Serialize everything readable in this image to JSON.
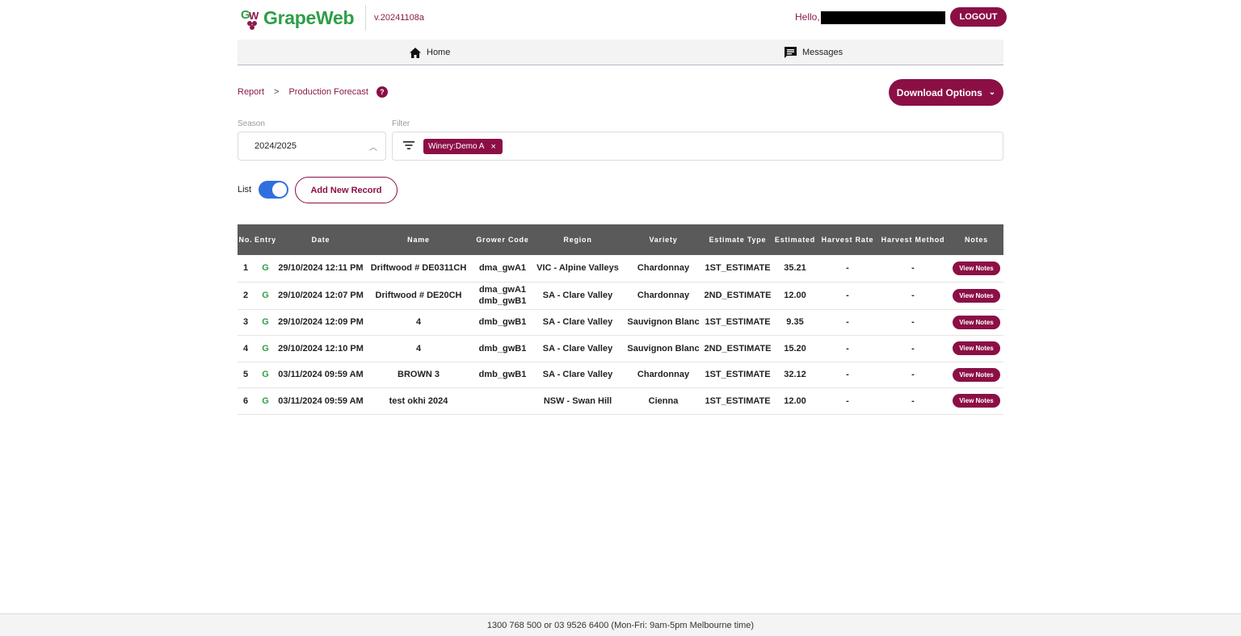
{
  "app": {
    "name": "GrapeWeb",
    "version": "v.20241108a"
  },
  "header": {
    "greeting": "Hello,",
    "logout_label": "LOGOUT"
  },
  "nav": {
    "items": [
      {
        "label": "Home",
        "icon": "home-icon"
      },
      {
        "label": "Messages",
        "icon": "message-icon"
      }
    ]
  },
  "breadcrumb": {
    "items": [
      "Report",
      "Production Forecast"
    ],
    "separator": ">",
    "help": "?"
  },
  "download": {
    "label": "Download Options",
    "chevron": "⌄"
  },
  "season": {
    "label": "Season",
    "value": "2024/2025"
  },
  "filter": {
    "label": "Filter",
    "chips": [
      {
        "label": "Winery:Demo A",
        "remove": "×"
      }
    ]
  },
  "view_toggle": {
    "label": "List",
    "on": true
  },
  "add_button": {
    "label": "Add New Record"
  },
  "table": {
    "headers": [
      "No.",
      "Entry",
      "Date",
      "Name",
      "Grower Code",
      "Region",
      "Variety",
      "Estimate Type",
      "Estimated",
      "Harvest Rate",
      "Harvest Method",
      "Notes"
    ],
    "rows": [
      {
        "no": "1",
        "entry": "G",
        "date": "29/10/2024 12:11 PM",
        "name": "Driftwood # DE0311CH",
        "grower_code": [
          "dma_gwA1"
        ],
        "region": "VIC - Alpine Valleys",
        "variety": "Chardonnay",
        "estimate_type": "1ST_ESTIMATE",
        "estimated": "35.21",
        "harvest_rate": "-",
        "harvest_method": "-",
        "notes": "View Notes"
      },
      {
        "no": "2",
        "entry": "G",
        "date": "29/10/2024 12:07 PM",
        "name": "Driftwood # DE20CH",
        "grower_code": [
          "dma_gwA1",
          "dmb_gwB1"
        ],
        "region": "SA - Clare Valley",
        "variety": "Chardonnay",
        "estimate_type": "2ND_ESTIMATE",
        "estimated": "12.00",
        "harvest_rate": "-",
        "harvest_method": "-",
        "notes": "View Notes"
      },
      {
        "no": "3",
        "entry": "G",
        "date": "29/10/2024 12:09 PM",
        "name": "4",
        "grower_code": [
          "dmb_gwB1"
        ],
        "region": "SA - Clare Valley",
        "variety": "Sauvignon Blanc",
        "estimate_type": "1ST_ESTIMATE",
        "estimated": "9.35",
        "harvest_rate": "-",
        "harvest_method": "-",
        "notes": "View Notes"
      },
      {
        "no": "4",
        "entry": "G",
        "date": "29/10/2024 12:10 PM",
        "name": "4",
        "grower_code": [
          "dmb_gwB1"
        ],
        "region": "SA - Clare Valley",
        "variety": "Sauvignon Blanc",
        "estimate_type": "2ND_ESTIMATE",
        "estimated": "15.20",
        "harvest_rate": "-",
        "harvest_method": "-",
        "notes": "View Notes"
      },
      {
        "no": "5",
        "entry": "G",
        "date": "03/11/2024 09:59 AM",
        "name": "BROWN 3",
        "grower_code": [
          "dmb_gwB1"
        ],
        "region": "SA - Clare Valley",
        "variety": "Chardonnay",
        "estimate_type": "1ST_ESTIMATE",
        "estimated": "32.12",
        "harvest_rate": "-",
        "harvest_method": "-",
        "notes": "View Notes"
      },
      {
        "no": "6",
        "entry": "G",
        "date": "03/11/2024 09:59 AM",
        "name": "test okhi 2024",
        "grower_code": [],
        "region": "NSW - Swan Hill",
        "variety": "Cienna",
        "estimate_type": "1ST_ESTIMATE",
        "estimated": "12.00",
        "harvest_rate": "-",
        "harvest_method": "-",
        "notes": "View Notes"
      }
    ]
  },
  "footer": {
    "text": "1300 768 500 or 03 9526 6400 (Mon-Fri: 9am-5pm Melbourne time)"
  },
  "colors": {
    "brand": "#8b0f45",
    "logo_green": "#2e9e47",
    "toggle_blue": "#2f6fe0",
    "table_header": "#5a5a5a"
  }
}
